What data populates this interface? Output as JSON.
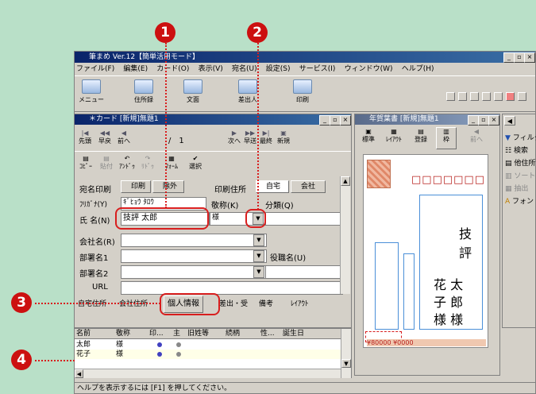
{
  "app": {
    "title": "筆まめ Ver.12【簡単活用モード】",
    "menus": [
      "ファイル(F)",
      "編集(E)",
      "カード(O)",
      "表示(V)",
      "宛名(U)",
      "設定(S)",
      "サービス(I)",
      "ウィンドウ(W)",
      "ヘルプ(H)"
    ],
    "toolbar": [
      "メニュー",
      "住所録",
      "文面",
      "差出人",
      "印刷"
    ],
    "status": "ヘルプを表示するには [F1] を押してください。"
  },
  "card": {
    "title": "＊カード [新規]無題1",
    "nav": {
      "first": "先頭",
      "prevpage": "早戻",
      "prev": "前へ",
      "next": "次へ",
      "nextpage": "早送",
      "last": "最終",
      "new": "新規",
      "position": "/　1"
    },
    "tools": [
      "ｺﾋﾟｰ",
      "貼付",
      "ｱﾝﾄﾞｩ",
      "ﾘﾄﾞｩ",
      "ﾌｫｰﾑ",
      "選択"
    ],
    "print_label": "宛名印刷",
    "print_btn": "印刷",
    "exclude_btn": "除外",
    "address_label": "印刷住所",
    "home_btn": "自宅",
    "company_btn": "会社",
    "furigana_label": "ﾌﾘｶﾞﾅ(Y)",
    "furigana_value": "ｷﾞﾋｮｳ ﾀﾛｳ",
    "name_label": "氏 名(N)",
    "name_value": "技評 太郎",
    "honorific_label": "敬称(K)",
    "honorific_value": "様",
    "category_label": "分類(Q)",
    "company_label": "会社名(R)",
    "dept1_label": "部署名1",
    "dept2_label": "部署名2",
    "title_label": "役職名(U)",
    "url_label": "URL",
    "tabs": [
      "自宅住所",
      "会社住所",
      "個人情報",
      "差出・受",
      "備考",
      "ﾚｲｱｳﾄ"
    ],
    "grid": {
      "headers": [
        "名前",
        "敬称",
        "印...",
        "主",
        "旧姓等",
        "続柄",
        "性...",
        "誕生日"
      ],
      "rows": [
        {
          "name": "太郎",
          "honorific": "様"
        },
        {
          "name": "花子",
          "honorific": "様"
        }
      ]
    }
  },
  "preview": {
    "title": "年賀葉書 [新規]無題1",
    "tools": [
      "標準",
      "ﾚｲｱｳﾄ",
      "登録",
      "枠",
      "前へ"
    ],
    "postal_boxes": "□□□□□□□",
    "line1": "技",
    "line2": "評",
    "name_a": "花 太",
    "name_b": "子 郎",
    "name_c": "様 様",
    "footer": "¥80000 ¥0000"
  },
  "side": {
    "items": [
      "フィルタ",
      "検索",
      "他住所",
      "ソート",
      "抽出",
      "フォント"
    ]
  },
  "callouts": [
    "1",
    "2",
    "3",
    "4"
  ],
  "colors": {
    "callout": "#cc1010",
    "highlight": "#d81e1e",
    "titlebar": "#0a246a"
  }
}
